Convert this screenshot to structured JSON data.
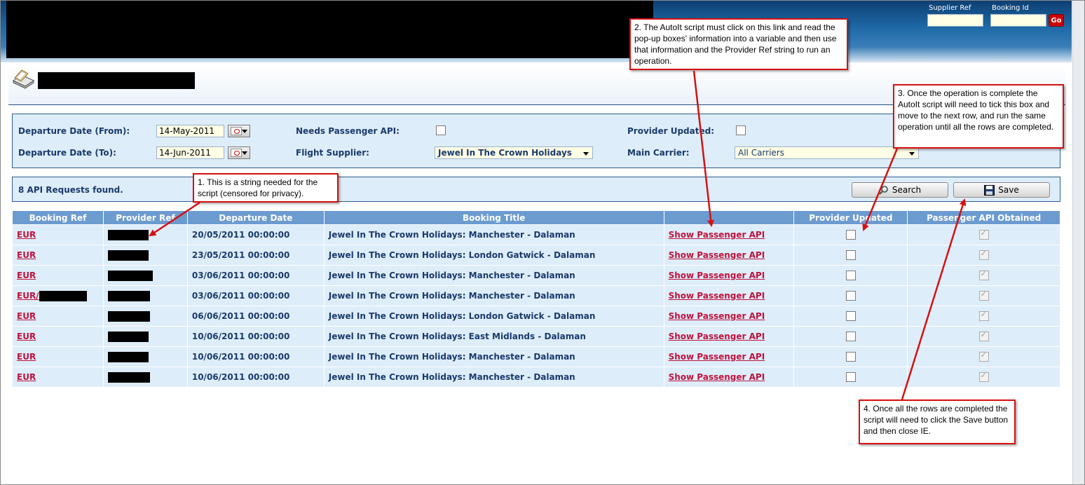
{
  "header": {
    "supplier_ref_label": "Supplier Ref",
    "booking_id_label": "Booking Id",
    "supplier_ref_value": "",
    "booking_id_value": "",
    "go_label": "Go"
  },
  "filters": {
    "departure_from_label": "Departure Date (From):",
    "departure_from_value": "14-May-2011",
    "departure_to_label": "Departure Date (To):",
    "departure_to_value": "14-Jun-2011",
    "needs_passenger_api_label": "Needs Passenger API:",
    "flight_supplier_label": "Flight Supplier:",
    "flight_supplier_value": "Jewel In The Crown Holidays",
    "provider_updated_label": "Provider Updated:",
    "main_carrier_label": "Main Carrier:",
    "main_carrier_value": "All Carriers"
  },
  "results": {
    "count_text": "8 API Requests found.",
    "search_label": "Search",
    "save_label": "Save"
  },
  "table": {
    "headers": [
      "Booking Ref",
      "Provider Ref",
      "Departure Date",
      "Booking Title",
      "",
      "Provider Updated",
      "Passenger API Obtained"
    ],
    "link_label": "Show Passenger API",
    "rows": [
      {
        "booking_ref": "EUR",
        "departure": "20/05/2011 00:00:00",
        "title": "Jewel In The Crown Holidays: Manchester - Dalaman"
      },
      {
        "booking_ref": "EUR",
        "departure": "23/05/2011 00:00:00",
        "title": "Jewel In The Crown Holidays: London Gatwick - Dalaman"
      },
      {
        "booking_ref": "EUR",
        "departure": "03/06/2011 00:00:00",
        "title": "Jewel In The Crown Holidays: Manchester - Dalaman"
      },
      {
        "booking_ref": "EUR/",
        "departure": "03/06/2011 00:00:00",
        "title": "Jewel In The Crown Holidays: Manchester - Dalaman"
      },
      {
        "booking_ref": "EUR",
        "departure": "06/06/2011 00:00:00",
        "title": "Jewel In The Crown Holidays: London Gatwick - Dalaman"
      },
      {
        "booking_ref": "EUR",
        "departure": "10/06/2011 00:00:00",
        "title": "Jewel In The Crown Holidays: East Midlands - Dalaman"
      },
      {
        "booking_ref": "EUR",
        "departure": "10/06/2011 00:00:00",
        "title": "Jewel In The Crown Holidays: Manchester - Dalaman"
      },
      {
        "booking_ref": "EUR",
        "departure": "10/06/2011 00:00:00",
        "title": "Jewel In The Crown Holidays: Manchester - Dalaman"
      }
    ]
  },
  "callouts": {
    "c1": "1. This is a string needed for the script (censored for privacy).",
    "c2": "2. The AutoIt script must click on this link and read the pop-up boxes' information into a variable and then use that information and the Provider Ref string to run an operation.",
    "c3": "3. Once the operation is complete the AutoIt script will need to tick this box and move to the next row, and run the same operation until all the rows are completed.",
    "c4": "4. Once all the rows are completed the script will need to click the Save button and then close IE."
  },
  "colors": {
    "accent": "#1a3a6b",
    "link": "#c0123c",
    "table_header": "#6c9bd0",
    "row_bg": "#deedfa",
    "annotation": "#d41111"
  },
  "icons": [
    "scanner-icon",
    "calendar-icon",
    "search-icon",
    "save-icon"
  ]
}
